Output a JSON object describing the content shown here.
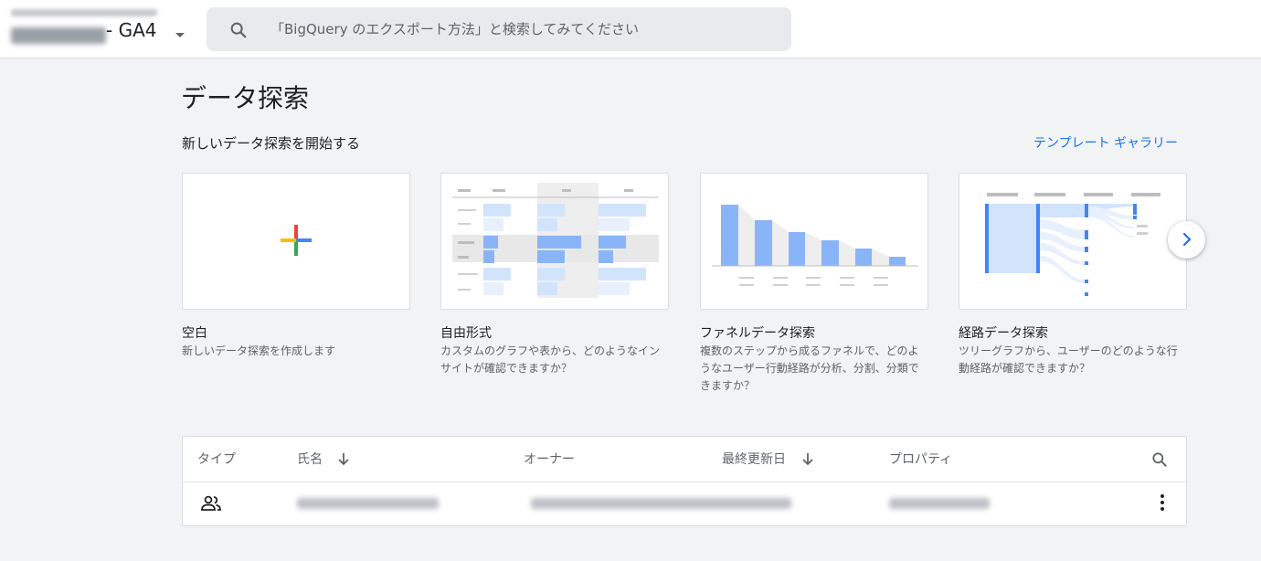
{
  "header": {
    "property_suffix": "- GA4",
    "search_placeholder": "「BigQuery のエクスポート方法」と検索してみてください"
  },
  "page": {
    "title": "データ探索",
    "section_title": "新しいデータ探索を開始する",
    "gallery_link": "テンプレート ギャラリー"
  },
  "cards": [
    {
      "title": "空白",
      "description": "新しいデータ探索を作成します"
    },
    {
      "title": "自由形式",
      "description": "カスタムのグラフや表から、どのようなインサイトが確認できますか？"
    },
    {
      "title": "ファネルデータ探索",
      "description": "複数のステップから成るファネルで、どのようなユーザー行動経路が分析、分割、分類できますか？"
    },
    {
      "title": "経路データ探索",
      "description": "ツリーグラフから、ユーザーのどのような行動経路が確認できますか？"
    }
  ],
  "table": {
    "columns": {
      "type": "タイプ",
      "name": "氏名",
      "owner": "オーナー",
      "updated": "最終更新日",
      "property": "プロパティ"
    },
    "rows": [
      {
        "type_icon": "people-icon"
      }
    ]
  },
  "colors": {
    "accent_blue": "#1a73e8",
    "chart_blue": "#8ab4f8",
    "chart_light_blue": "#d2e3fc",
    "google_red": "#ea4335",
    "google_blue": "#4285f4",
    "google_green": "#34a853",
    "google_yellow": "#fbbc04"
  }
}
